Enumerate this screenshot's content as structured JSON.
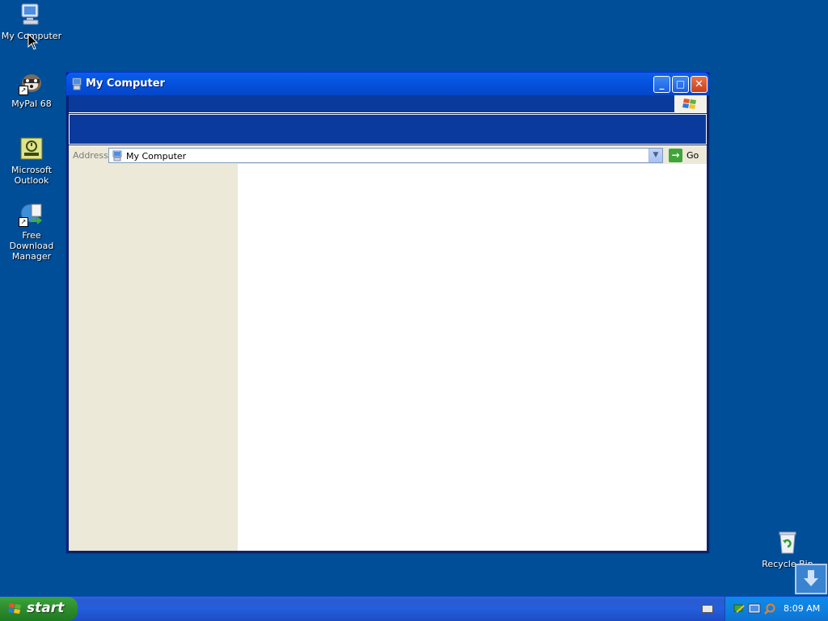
{
  "desktop": {
    "icons": [
      {
        "label": "My Computer",
        "icon": "my-computer-icon"
      },
      {
        "label": "MyPal 68",
        "icon": "raccoon-icon"
      },
      {
        "label": "Microsoft Outlook",
        "icon": "outlook-icon"
      },
      {
        "label": "Free Download Manager",
        "icon": "download-manager-icon"
      },
      {
        "label": "Recycle Bin",
        "icon": "recycle-bin-icon"
      }
    ]
  },
  "window": {
    "title": "My Computer",
    "buttons": {
      "minimize": "minimize-icon",
      "maximize": "maximize-icon",
      "close": "close-icon"
    },
    "address": {
      "label": "Address",
      "value": "My Computer",
      "go_label": "Go"
    }
  },
  "taskbar": {
    "start_label": "start",
    "clock": "8:09 AM"
  },
  "colors": {
    "desktop": "#004e98",
    "taskbar": "#245edb",
    "start": "#2e8b2e",
    "taskpane": "#ece9d8"
  }
}
